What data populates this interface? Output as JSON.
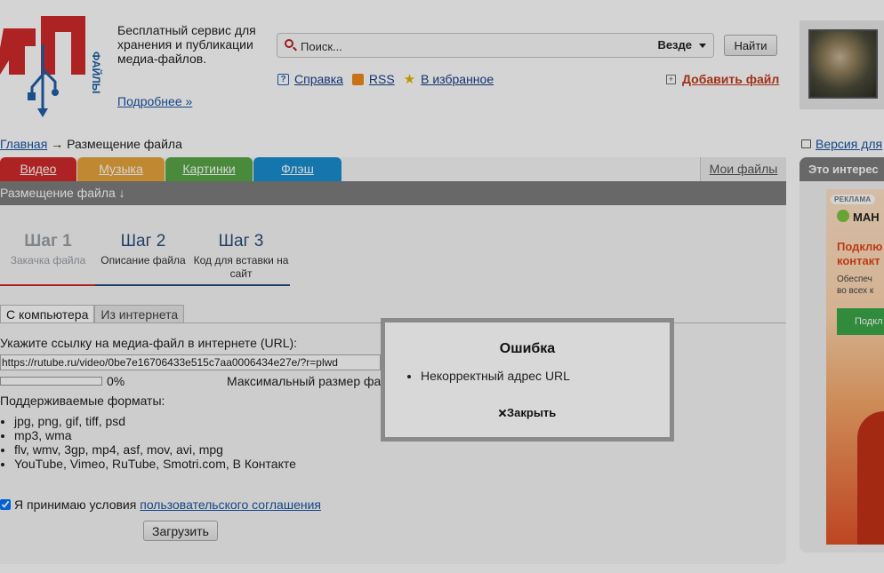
{
  "header": {
    "tagline": "Бесплатный сервис для хранения и публикации медиа-файлов.",
    "more_link": "Подробнее »",
    "logo_vertical_text": "ФАЙЛЫ"
  },
  "search": {
    "placeholder": "Поиск...",
    "scope": "Везде",
    "button": "Найти"
  },
  "toolbar": {
    "help": "Справка",
    "rss": "RSS",
    "favorites": "В избранное",
    "add_file": "Добавить файл"
  },
  "breadcrumb": {
    "home": "Главная",
    "separator": " → ",
    "current": "Размещение файла"
  },
  "print_version": "Версия для",
  "tabs": [
    {
      "label": "Видео",
      "color": "#d02a2a"
    },
    {
      "label": "Музыка",
      "color": "#e7a43b"
    },
    {
      "label": "Картинки",
      "color": "#5aa847"
    },
    {
      "label": "Флэш",
      "color": "#1a8fd0"
    }
  ],
  "my_files": "Мои файлы",
  "section_title": "Размещение файла ↓",
  "steps": [
    {
      "title": "Шаг 1",
      "subtitle": "Закачка файла"
    },
    {
      "title": "Шаг 2",
      "subtitle": "Описание файла"
    },
    {
      "title": "Шаг 3",
      "subtitle": "Код для вставки на сайт"
    }
  ],
  "subtabs": {
    "computer": "С компьютера",
    "internet": "Из интернета"
  },
  "form": {
    "url_label": "Укажите ссылку на медиа-файл в интернете (URL):",
    "url_value": "https://rutube.ru/video/0be7e16706433e515c7aa0006434e27e/?r=plwd",
    "progress_percent": 0,
    "progress_text": "0%",
    "max_size": "Максимальный размер фа",
    "formats_label": "Поддерживаемые форматы:",
    "formats": [
      "jpg, png, gif, tiff, psd",
      "mp3, wma",
      "flv, wmv, 3gp, mp4, asf, mov, avi, mpg",
      "YouTube, Vimeo, RuTube, Smotri.com, В Контакте"
    ],
    "agree_prefix": "Я принимаю условия ",
    "agree_link": "пользовательского соглашения",
    "agree_checked": true,
    "upload_button": "Загрузить"
  },
  "sidebar": {
    "heading": "Это интерес",
    "ad": {
      "badge": "РЕКЛАМА",
      "brand": "МАН",
      "headline_1": "Подклю",
      "headline_2": "контакт",
      "text_1": "Обеспеч",
      "text_2": "во всех к",
      "button": "Подкл"
    }
  },
  "modal": {
    "title": "Ошибка",
    "errors": [
      "Некорректный адрес URL"
    ],
    "close": "Закрыть"
  }
}
